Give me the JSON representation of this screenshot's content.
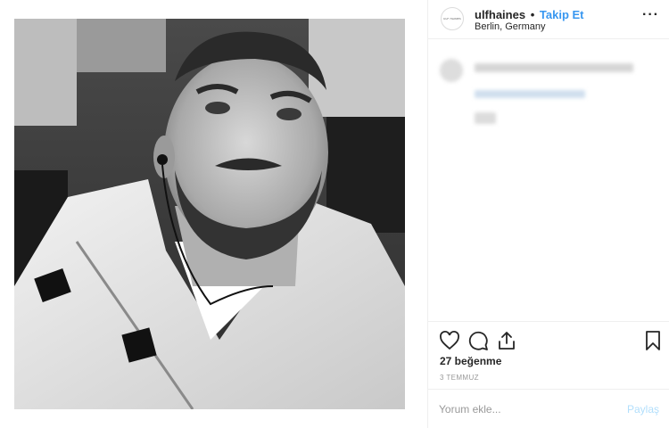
{
  "post": {
    "photo_icon": "selfie-photo",
    "username": "ulfhaines",
    "separator": "•",
    "follow_label": "Takip Et",
    "location": "Berlin, Germany",
    "avatar_text": "ULF HAINES",
    "more_icon": "more-options-icon"
  },
  "actions": {
    "like_icon": "heart-icon",
    "comment_icon": "comment-icon",
    "share_icon": "share-icon",
    "save_icon": "bookmark-icon"
  },
  "stats": {
    "likes": "27 beğenme",
    "date": "3 TEMMUZ"
  },
  "comment": {
    "placeholder": "Yorum ekle...",
    "submit_label": "Paylaş"
  },
  "colors": {
    "accent": "#3897f0",
    "submit_disabled": "#b2dffc",
    "border": "#efefef"
  }
}
